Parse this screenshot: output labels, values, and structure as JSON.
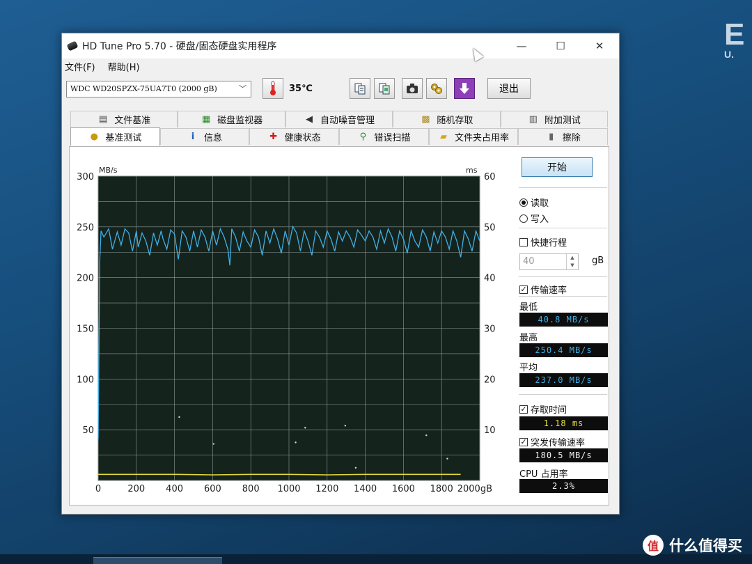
{
  "desktop": {
    "edge_text": "E",
    "edge_sub": "U."
  },
  "watermark": {
    "logo": "值",
    "text": "什么值得买"
  },
  "window": {
    "title": "HD Tune Pro 5.70 - 硬盘/固态硬盘实用程序",
    "minimize_icon": "—",
    "maximize_icon": "☐",
    "close_icon": "✕"
  },
  "menu": {
    "file": "文件(F)",
    "help": "帮助(H)"
  },
  "toolbar": {
    "drive": "WDC WD20SPZX-75UA7T0 (2000 gB)",
    "temperature": "35℃",
    "exit": "退出"
  },
  "tabs_row1": [
    {
      "label": "文件基准",
      "icon": "document-icon"
    },
    {
      "label": "磁盘监视器",
      "icon": "monitor-icon"
    },
    {
      "label": "自动噪音管理",
      "icon": "speaker-icon"
    },
    {
      "label": "随机存取",
      "icon": "random-icon"
    },
    {
      "label": "附加测试",
      "icon": "extra-test-icon"
    }
  ],
  "tabs_row2": [
    {
      "label": "基准测试",
      "icon": "benchmark-icon",
      "active": true
    },
    {
      "label": "信息",
      "icon": "info-icon"
    },
    {
      "label": "健康状态",
      "icon": "health-icon"
    },
    {
      "label": "错误扫描",
      "icon": "magnifier-icon"
    },
    {
      "label": "文件夹占用率",
      "icon": "folder-icon"
    },
    {
      "label": "擦除",
      "icon": "trash-icon"
    }
  ],
  "chart_data": {
    "type": "line",
    "y_unit_left": "MB/s",
    "y_unit_right": "ms",
    "x_unit": "gB",
    "x_ticks": [
      0,
      200,
      400,
      600,
      800,
      1000,
      1200,
      1400,
      1600,
      1800,
      2000
    ],
    "x_tick_labels": [
      "0",
      "200",
      "400",
      "600",
      "800",
      "1000",
      "1200",
      "1400",
      "1600",
      "1800",
      "2000gB"
    ],
    "y_left_ticks": [
      50,
      100,
      150,
      200,
      250,
      300
    ],
    "y_right_ticks": [
      10,
      20,
      30,
      40,
      50,
      60
    ],
    "xlim": [
      0,
      2000
    ],
    "ylim_left": [
      0,
      300
    ],
    "ylim_right": [
      0,
      60
    ],
    "grid": true,
    "series": [
      {
        "color": "#3fb0e6",
        "axis": "left",
        "x": [
          0,
          8,
          15,
          30,
          55,
          75,
          100,
          120,
          140,
          160,
          180,
          200,
          210,
          230,
          250,
          270,
          290,
          310,
          330,
          340,
          360,
          380,
          400,
          420,
          440,
          460,
          480,
          500,
          520,
          540,
          560,
          580,
          600,
          620,
          640,
          660,
          680,
          690,
          700,
          720,
          740,
          760,
          780,
          800,
          820,
          840,
          860,
          880,
          900,
          920,
          940,
          960,
          980,
          1000,
          1020,
          1040,
          1060,
          1080,
          1100,
          1120,
          1140,
          1160,
          1180,
          1200,
          1220,
          1240,
          1260,
          1280,
          1300,
          1320,
          1340,
          1360,
          1380,
          1400,
          1420,
          1440,
          1460,
          1480,
          1500,
          1520,
          1540,
          1560,
          1580,
          1600,
          1620,
          1640,
          1660,
          1680,
          1700,
          1720,
          1740,
          1760,
          1780,
          1800,
          1820,
          1840,
          1860,
          1880,
          1900,
          1920,
          1940,
          1960,
          1980,
          2000
        ],
        "y": [
          40.8,
          215,
          246,
          240,
          248,
          228,
          245,
          232,
          248,
          244,
          226,
          246,
          230,
          244,
          236,
          222,
          244,
          232,
          246,
          238,
          228,
          247,
          243,
          218,
          246,
          240,
          226,
          246,
          230,
          247,
          240,
          226,
          246,
          232,
          248,
          240,
          228,
          212,
          248,
          240,
          226,
          245,
          236,
          230,
          247,
          240,
          222,
          246,
          234,
          248,
          238,
          224,
          246,
          232,
          250.4,
          244,
          226,
          246,
          236,
          222,
          246,
          240,
          230,
          246,
          238,
          226,
          245,
          236,
          246,
          240,
          230,
          247,
          242,
          236,
          246,
          240,
          228,
          246,
          234,
          248,
          240,
          226,
          246,
          238,
          224,
          246,
          236,
          230,
          247,
          240,
          226,
          245,
          234,
          246,
          240,
          228,
          246,
          236,
          220,
          246,
          238,
          226,
          246,
          236
        ]
      },
      {
        "color": "#e2d840",
        "axis": "right",
        "x": [
          0,
          200,
          400,
          600,
          800,
          1000,
          1200,
          1400,
          1600,
          1800,
          1900
        ],
        "y": [
          1.2,
          1.2,
          1.2,
          1.1,
          1.2,
          1.2,
          1.1,
          1.2,
          1.2,
          1.2,
          1.2
        ]
      }
    ],
    "scatter": {
      "color": "#d8d8d8",
      "axis": "right",
      "x": [
        425,
        605,
        1035,
        1085,
        1295,
        1350,
        1720,
        1830
      ],
      "y": [
        12.5,
        7.2,
        7.5,
        10.4,
        10.8,
        2.5,
        8.9,
        4.3
      ]
    }
  },
  "side": {
    "start": "开始",
    "read": "读取",
    "write": "写入",
    "quick": "快捷行程",
    "quick_value": "40",
    "quick_unit": "gB",
    "transfer": "传输速率",
    "min_label": "最低",
    "min_value": "40.8 MB/s",
    "max_label": "最高",
    "max_value": "250.4 MB/s",
    "avg_label": "平均",
    "avg_value": "237.0 MB/s",
    "access": "存取时间",
    "access_value": "1.18 ms",
    "burst": "突发传输速率",
    "burst_value": "180.5 MB/s",
    "cpu_label": "CPU 占用率",
    "cpu_value": "2.3%",
    "check_mark": "✓",
    "colors": {
      "blue_readout": "#3fb0e6",
      "yellow_readout": "#e8e040",
      "white_readout": "#f2f2f2"
    }
  }
}
